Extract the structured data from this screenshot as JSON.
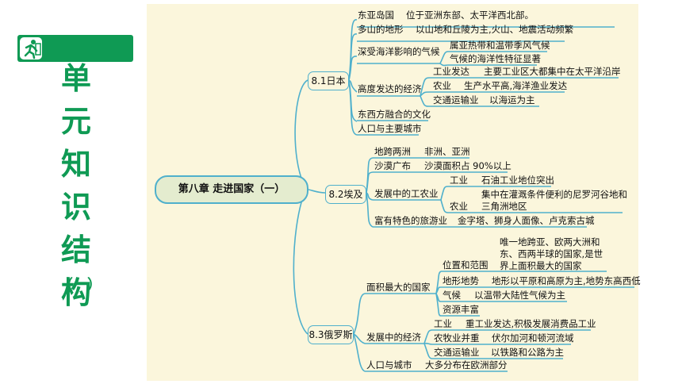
{
  "slide": {
    "title_chars": [
      "单",
      "元",
      "知",
      "识",
      "结",
      "构"
    ],
    "subtitle": "（一）"
  },
  "mindmap": {
    "center": "第八章  走进国家（一）",
    "japan": {
      "label": "8.1日本",
      "items": [
        {
          "topic": "东亚岛国",
          "detail": "位于亚洲东部、太平洋西北部。"
        },
        {
          "topic": "多山的地形",
          "detail": "以山地和丘陵为主,火山、地震活动频繁"
        },
        {
          "topic": "深受海洋影响的气候",
          "details": [
            "属亚热带和温带季风气候",
            "气候的海洋性特征显著"
          ]
        },
        {
          "topic": "高度发达的经济",
          "subs": [
            {
              "topic": "工业发达",
              "detail": "主要工业区大都集中在太平洋沿岸"
            },
            {
              "topic": "农业",
              "detail": "生产水平高,海洋渔业发达"
            },
            {
              "topic": "交通运输业",
              "detail": "以海运为主"
            }
          ]
        },
        {
          "topic": "东西方融合的文化"
        },
        {
          "topic": "人口与主要城市"
        }
      ]
    },
    "egypt": {
      "label": "8.2埃及",
      "items": [
        {
          "topic": "地跨两洲",
          "detail": "非洲、亚洲"
        },
        {
          "topic": "沙漠广布",
          "detail": "沙漠面积占 90%以上"
        },
        {
          "topic": "发展中的工农业",
          "subs": [
            {
              "topic": "工业",
              "detail": "石油工业地位突出"
            },
            {
              "topic": "农业",
              "detail_lines": [
                "集中在灌溉条件便利的尼罗河谷地和",
                "三角洲地区"
              ]
            }
          ]
        },
        {
          "topic": "富有特色的旅游业",
          "detail": "金字塔、狮身人面像、卢克索古城"
        }
      ]
    },
    "russia": {
      "label": "8.3俄罗斯",
      "items": [
        {
          "topic": "面积最大的国家",
          "subs": [
            {
              "topic": "位置和范围",
              "detail_lines": [
                "唯一地跨亚、欧两大洲和",
                "东、西两半球的国家,是世",
                "界上面积最大的国家"
              ]
            },
            {
              "topic": "地形地势",
              "detail": "地形以平原和高原为主,地势东高西低"
            },
            {
              "topic": "气候",
              "detail": "以温带大陆性气候为主"
            },
            {
              "topic": "资源丰富"
            }
          ]
        },
        {
          "topic": "发展中的经济",
          "subs": [
            {
              "topic": "工业",
              "detail": "重工业发达,积极发展消费品工业"
            },
            {
              "topic": "农牧业并重",
              "detail": "伏尔加河和顿河流域"
            },
            {
              "topic": "交通运输业",
              "detail": "以铁路和公路为主"
            }
          ]
        },
        {
          "topic": "人口与城市",
          "detail": "大多分布在欧洲部分"
        }
      ]
    }
  },
  "colors": {
    "brand_green": "#0f9a54",
    "branch_blue": "#4fb0cc",
    "canvas": "#fbf6dc"
  }
}
